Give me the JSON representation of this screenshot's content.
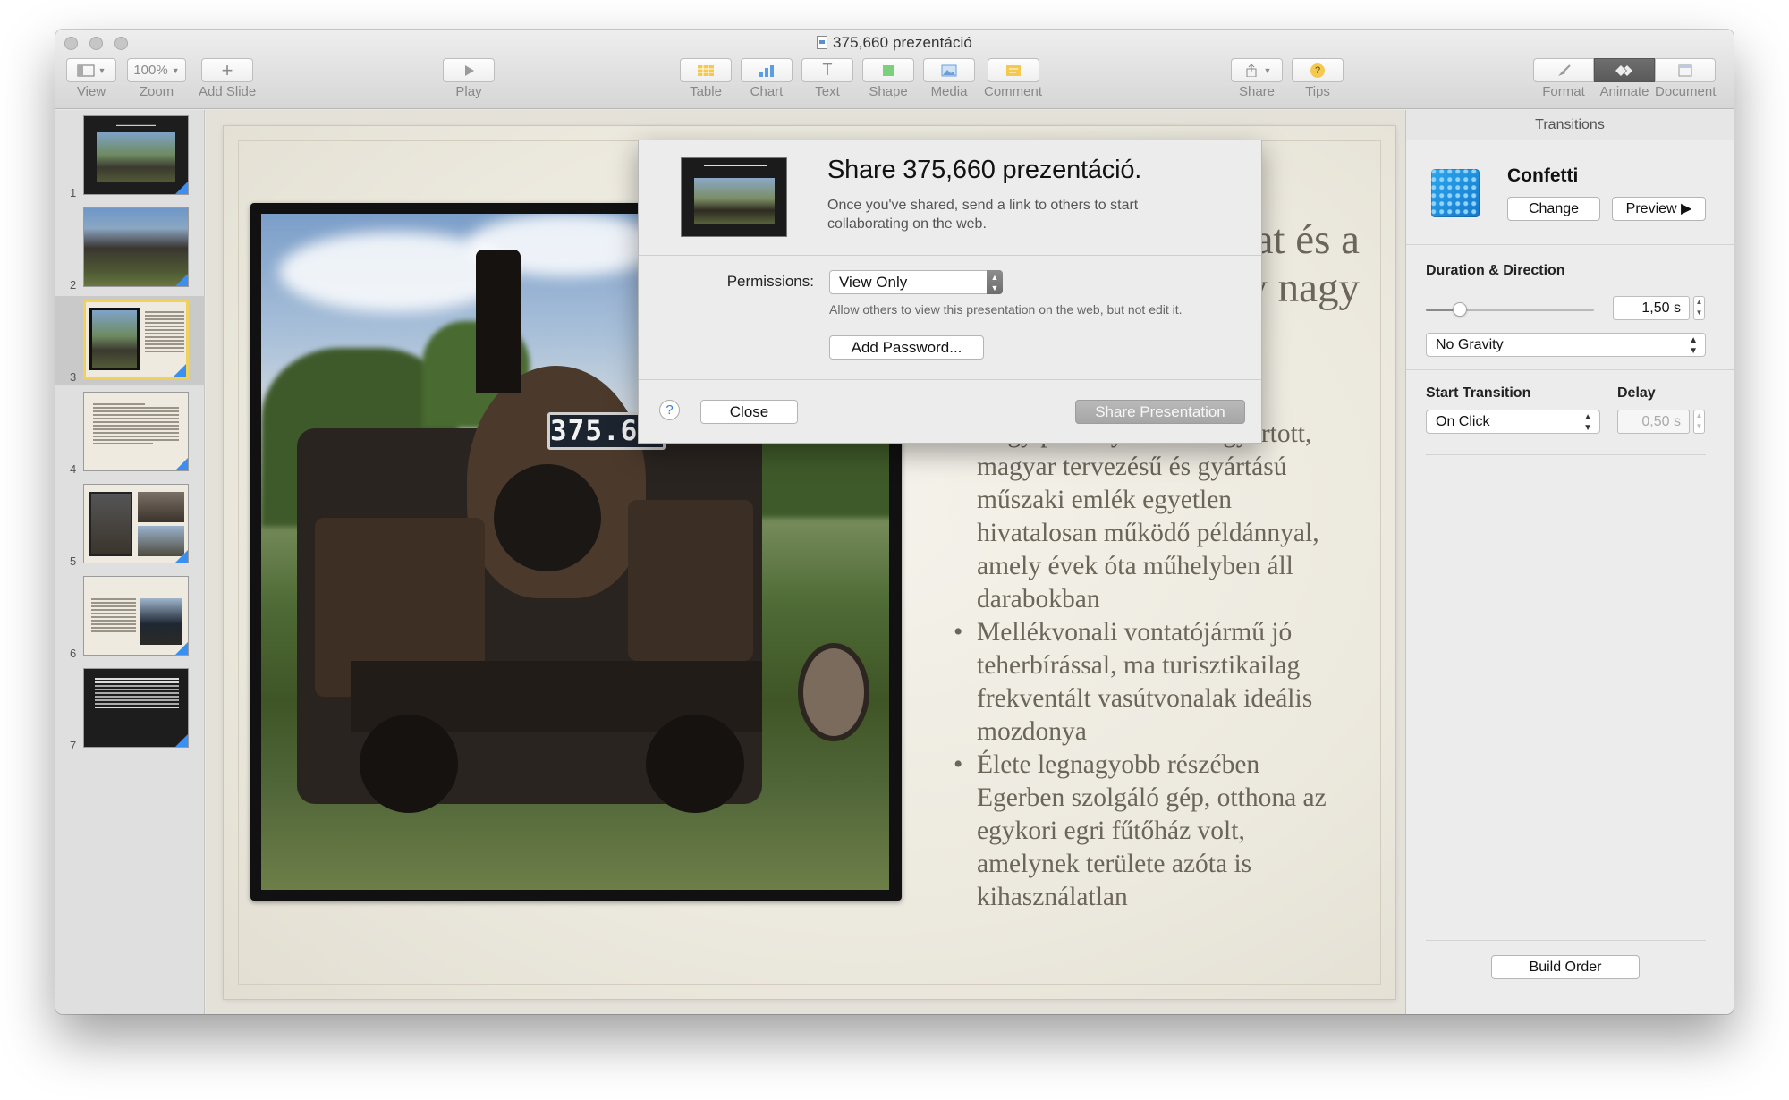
{
  "window": {
    "title": "375,660 prezentáció"
  },
  "toolbar": {
    "view": "View",
    "zoom_value": "100%",
    "zoom": "Zoom",
    "add_slide": "Add Slide",
    "play": "Play",
    "table": "Table",
    "chart": "Chart",
    "text": "Text",
    "shape": "Shape",
    "media": "Media",
    "comment": "Comment",
    "share": "Share",
    "tips": "Tips",
    "format": "Format",
    "animate": "Animate",
    "document": "Document"
  },
  "navigator": {
    "slides": [
      {
        "number": "1"
      },
      {
        "number": "2"
      },
      {
        "number": "3",
        "selected": true
      },
      {
        "number": "4"
      },
      {
        "number": "5"
      },
      {
        "number": "6"
      },
      {
        "number": "7"
      }
    ]
  },
  "slide": {
    "heading_visible": "ozat és a\nny nagy",
    "plate_number": "375.660",
    "bullets": [
      "Nagy példányszámban gyártott, magyar tervezésű és gyártású műszaki emlék egyetlen hivatalosan működő példánnyal, amely évek óta műhelyben áll darabokban",
      "Mellékvonali vontatójármű jó teherbírással, ma turisztikailag frekventált vasútvonalak ideális mozdonya",
      "Élete legnagyobb részében Egerben szolgáló gép, otthona az egykori egri fűtőház volt, amelynek területe azóta is kihasználatlan"
    ]
  },
  "share_sheet": {
    "title": "Share 375,660 prezentáció.",
    "description": "Once you've shared, send a link to others to start collaborating on the web.",
    "permissions_label": "Permissions:",
    "permissions_value": "View Only",
    "permissions_hint": "Allow others to view this presentation on the web, but not edit it.",
    "add_password": "Add Password...",
    "help": "?",
    "close": "Close",
    "share_presentation": "Share Presentation"
  },
  "inspector": {
    "header": "Transitions",
    "transition_name": "Confetti",
    "change": "Change",
    "preview": "Preview ▶",
    "duration_heading": "Duration & Direction",
    "duration_value": "1,50 s",
    "duration_fraction": 0.2,
    "gravity": "No Gravity",
    "start_heading": "Start Transition",
    "delay_heading": "Delay",
    "start_value": "On Click",
    "delay_value": "0,50 s",
    "build_order": "Build Order"
  },
  "colors": {
    "accent_blue": "#3b8ff0",
    "selected_thumb_border": "#f0d25a",
    "slide_text": "#6b655a"
  }
}
